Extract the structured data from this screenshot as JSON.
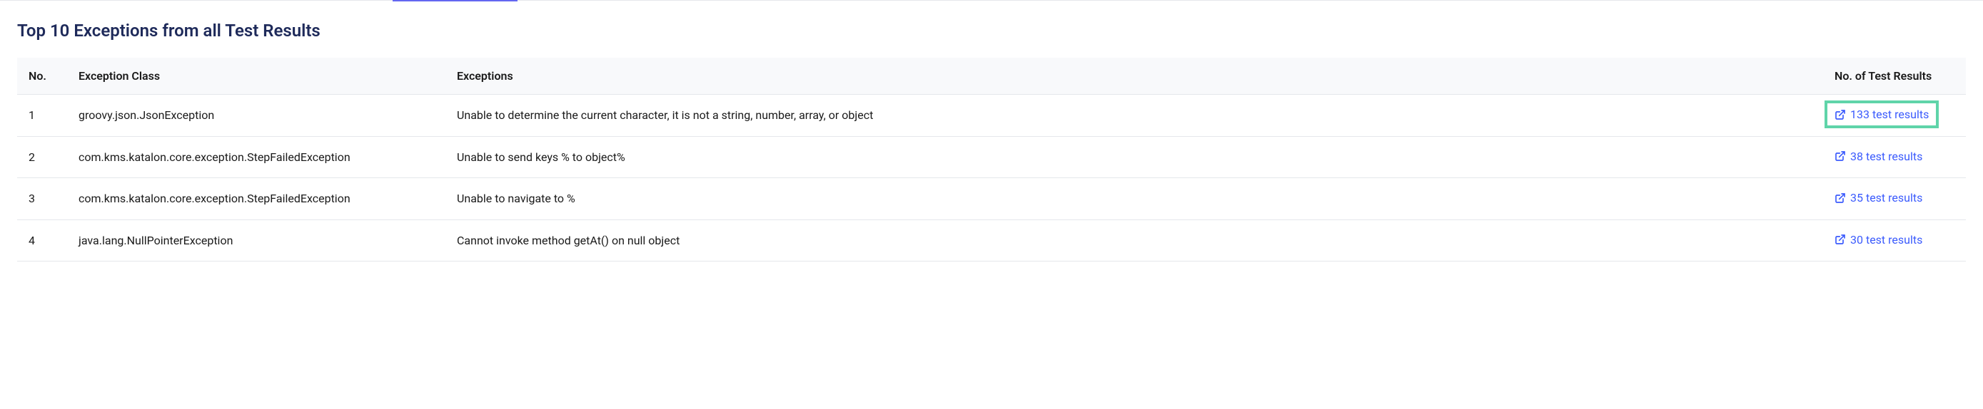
{
  "section": {
    "title": "Top 10 Exceptions from all Test Results"
  },
  "table": {
    "headers": {
      "no": "No.",
      "class": "Exception Class",
      "exceptions": "Exceptions",
      "results": "No. of Test Results"
    },
    "rows": [
      {
        "no": "1",
        "class": "groovy.json.JsonException",
        "exceptions": "Unable to determine the current character, it is not a string, number, array, or object",
        "results_label": "133 test results",
        "highlighted": true
      },
      {
        "no": "2",
        "class": "com.kms.katalon.core.exception.StepFailedException",
        "exceptions": "Unable to send keys % to object%",
        "results_label": "38 test results",
        "highlighted": false
      },
      {
        "no": "3",
        "class": "com.kms.katalon.core.exception.StepFailedException",
        "exceptions": "Unable to navigate to %",
        "results_label": "35 test results",
        "highlighted": false
      },
      {
        "no": "4",
        "class": "java.lang.NullPointerException",
        "exceptions": "Cannot invoke method getAt() on null object",
        "results_label": "30 test results",
        "highlighted": false
      }
    ]
  }
}
